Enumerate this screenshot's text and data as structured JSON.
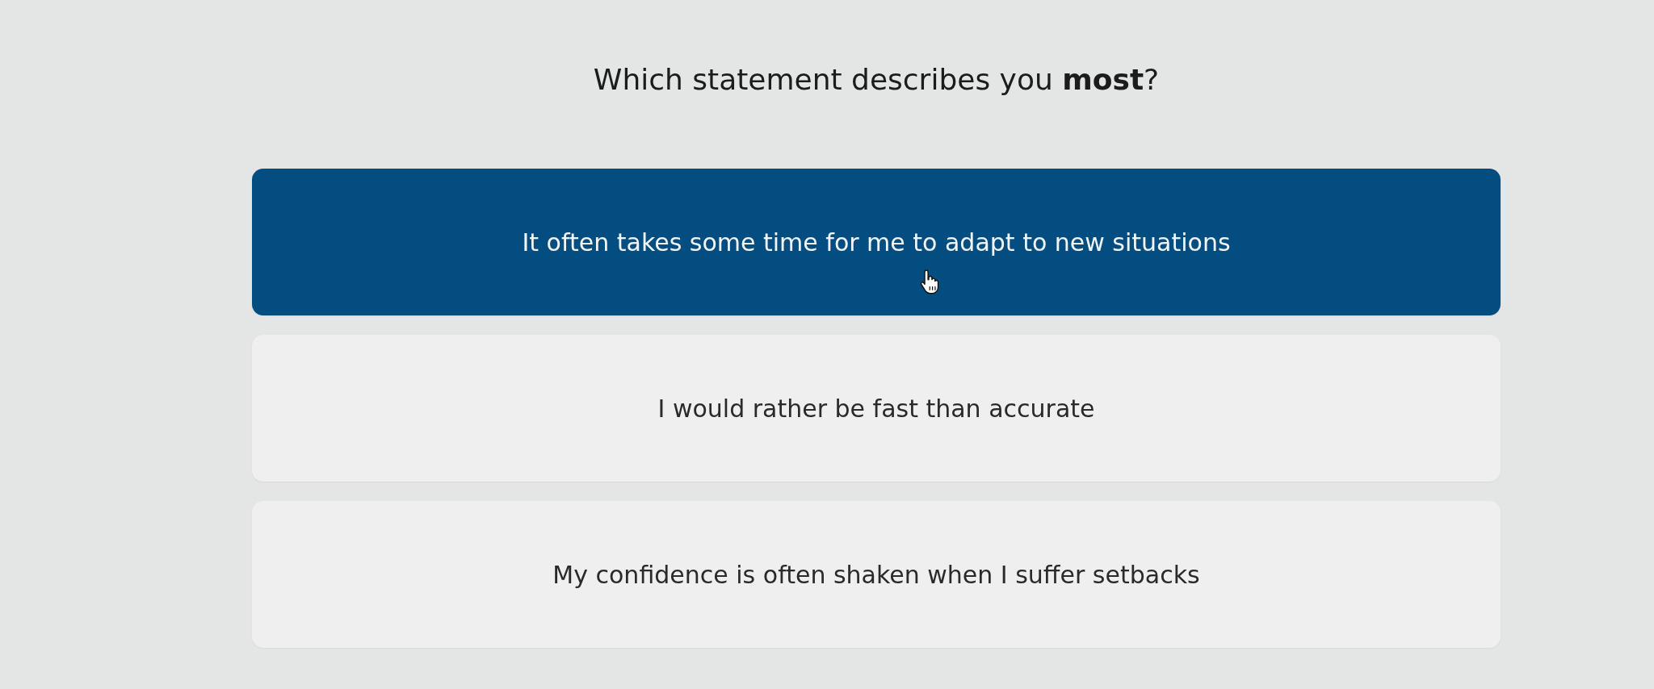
{
  "question": "Which statement describes you **most**?",
  "options": [
    {
      "label": "It often takes some time for me to adapt to new situations",
      "selected": true
    },
    {
      "label": "I would rather be fast than accurate",
      "selected": false
    },
    {
      "label": "My confidence is often shaken when I suffer setbacks",
      "selected": false
    }
  ]
}
